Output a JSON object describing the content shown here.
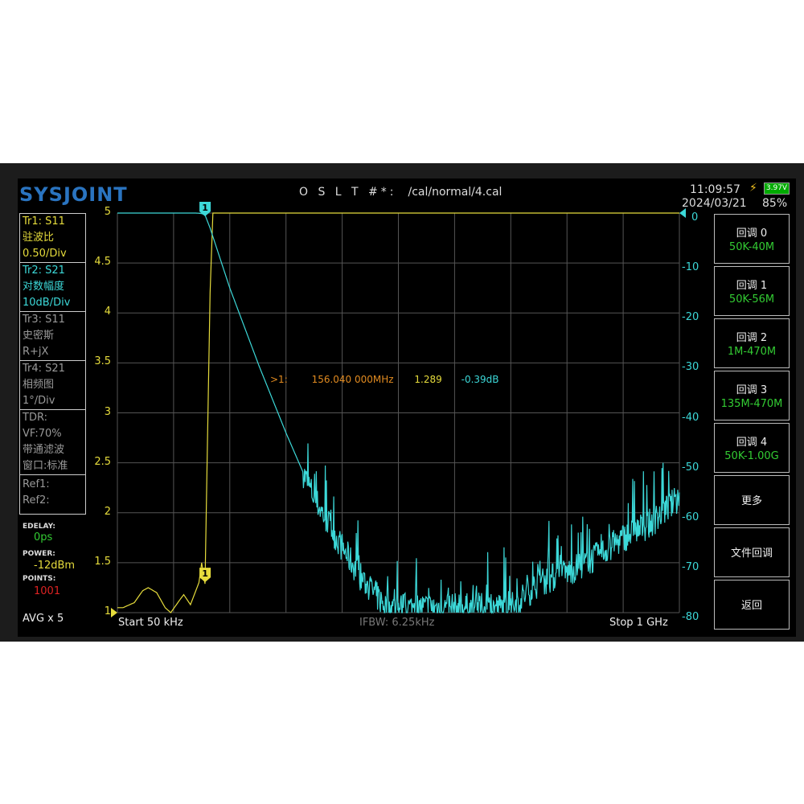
{
  "header": {
    "logo": "SYSJOINT",
    "cal_label": "O S L T #*:",
    "cal_file": "/cal/normal/4.cal",
    "time": "11:09:57",
    "date": "2024/03/21",
    "battery_voltage": "3.97V",
    "battery_percent": "85%"
  },
  "traces": [
    {
      "id": "Tr1: S11",
      "type": "驻波比",
      "scale": "0.50/Div"
    },
    {
      "id": "Tr2: S21",
      "type": "对数幅度",
      "scale": "10dB/Div"
    },
    {
      "id": "Tr3: S11",
      "type": "史密斯",
      "scale": "R+jX"
    },
    {
      "id": "Tr4: S21",
      "type": "相频图",
      "scale": "1°/Div"
    }
  ],
  "tdr": {
    "label": "TDR:",
    "vf": "VF:70%",
    "filter": "带通滤波",
    "window": "窗口:标准"
  },
  "refs": {
    "ref1": "Ref1:",
    "ref2": "Ref2:"
  },
  "settings": {
    "edelay_label": "EDELAY:",
    "edelay": "0ps",
    "power_label": "POWER:",
    "power": "-12dBm",
    "points_label": "POINTS:",
    "points": "1001",
    "avg": "AVG x 5"
  },
  "left_axis": [
    "5",
    "4.5",
    "4",
    "3.5",
    "3",
    "2.5",
    "2",
    "1.5",
    "1"
  ],
  "right_axis": [
    "0",
    "-10",
    "-20",
    "-30",
    "-40",
    "-50",
    "-60",
    "-70",
    "-80"
  ],
  "footer": {
    "start": "Start  50 kHz",
    "ifbw": "IFBW: 6.25kHz",
    "stop": "Stop  1 GHz"
  },
  "marker": {
    "label": "1",
    "readout_id": ">1:",
    "frequency": "156.040 000MHz",
    "swr": "1.289",
    "s21": "-0.39dB",
    "freq_mhz": 156.04
  },
  "buttons": [
    {
      "label": "回调 0",
      "sub": "50K-40M"
    },
    {
      "label": "回调 1",
      "sub": "50K-56M"
    },
    {
      "label": "回调 2",
      "sub": "1M-470M"
    },
    {
      "label": "回调 3",
      "sub": "135M-470M"
    },
    {
      "label": "回调 4",
      "sub": "50K-1.00G"
    },
    {
      "label": "更多"
    },
    {
      "label": "文件回调"
    },
    {
      "label": "返回"
    }
  ],
  "chart_data": {
    "type": "line",
    "x_unit": "MHz",
    "xlim": [
      0.05,
      1000
    ],
    "series": [
      {
        "name": "Tr1 S11 SWR",
        "axis": "left",
        "ylim": [
          1,
          5
        ],
        "color": "#e6dc3c",
        "points": [
          [
            0,
            1.05
          ],
          [
            10,
            1.05
          ],
          [
            30,
            1.1
          ],
          [
            45,
            1.22
          ],
          [
            55,
            1.25
          ],
          [
            70,
            1.2
          ],
          [
            85,
            1.05
          ],
          [
            95,
            1.0
          ],
          [
            110,
            1.12
          ],
          [
            118,
            1.18
          ],
          [
            130,
            1.08
          ],
          [
            145,
            1.3
          ],
          [
            150,
            1.5
          ],
          [
            156,
            1.289
          ],
          [
            160,
            2.6
          ],
          [
            165,
            4.2
          ],
          [
            170,
            5
          ],
          [
            1000,
            5
          ]
        ]
      },
      {
        "name": "Tr2 S21 LogMag",
        "axis": "right",
        "ylim": [
          -80,
          0
        ],
        "color": "#3cd8d8",
        "points": [
          [
            0,
            0
          ],
          [
            140,
            0
          ],
          [
            150,
            -0.1
          ],
          [
            156,
            -0.39
          ],
          [
            165,
            -3
          ],
          [
            200,
            -15
          ],
          [
            250,
            -30
          ],
          [
            300,
            -44
          ],
          [
            350,
            -57
          ],
          [
            400,
            -67
          ],
          [
            440,
            -74
          ],
          [
            480,
            -79
          ],
          [
            700,
            -79
          ],
          [
            750,
            -74
          ],
          [
            800,
            -72
          ],
          [
            850,
            -69
          ],
          [
            900,
            -65
          ],
          [
            950,
            -62
          ],
          [
            1000,
            -57
          ]
        ]
      }
    ]
  }
}
